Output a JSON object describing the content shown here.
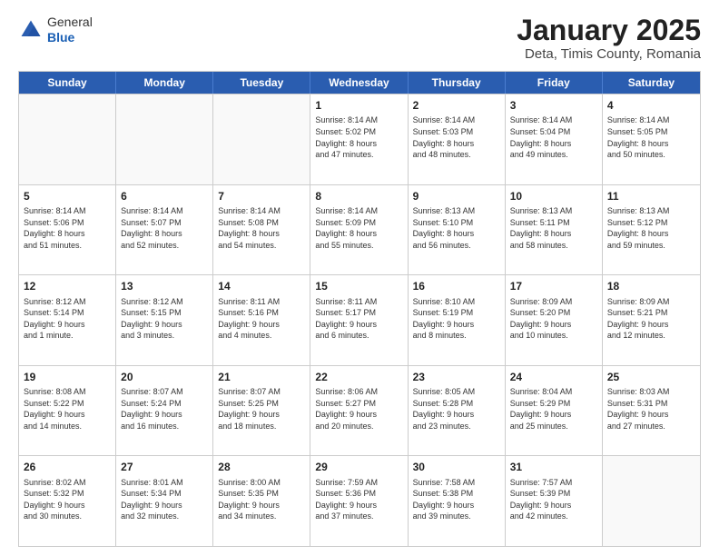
{
  "logo": {
    "general": "General",
    "blue": "Blue"
  },
  "title": "January 2025",
  "subtitle": "Deta, Timis County, Romania",
  "days_of_week": [
    "Sunday",
    "Monday",
    "Tuesday",
    "Wednesday",
    "Thursday",
    "Friday",
    "Saturday"
  ],
  "weeks": [
    [
      {
        "day": "",
        "text": "",
        "empty": true
      },
      {
        "day": "",
        "text": "",
        "empty": true
      },
      {
        "day": "",
        "text": "",
        "empty": true
      },
      {
        "day": "1",
        "text": "Sunrise: 8:14 AM\nSunset: 5:02 PM\nDaylight: 8 hours\nand 47 minutes."
      },
      {
        "day": "2",
        "text": "Sunrise: 8:14 AM\nSunset: 5:03 PM\nDaylight: 8 hours\nand 48 minutes."
      },
      {
        "day": "3",
        "text": "Sunrise: 8:14 AM\nSunset: 5:04 PM\nDaylight: 8 hours\nand 49 minutes."
      },
      {
        "day": "4",
        "text": "Sunrise: 8:14 AM\nSunset: 5:05 PM\nDaylight: 8 hours\nand 50 minutes."
      }
    ],
    [
      {
        "day": "5",
        "text": "Sunrise: 8:14 AM\nSunset: 5:06 PM\nDaylight: 8 hours\nand 51 minutes."
      },
      {
        "day": "6",
        "text": "Sunrise: 8:14 AM\nSunset: 5:07 PM\nDaylight: 8 hours\nand 52 minutes."
      },
      {
        "day": "7",
        "text": "Sunrise: 8:14 AM\nSunset: 5:08 PM\nDaylight: 8 hours\nand 54 minutes."
      },
      {
        "day": "8",
        "text": "Sunrise: 8:14 AM\nSunset: 5:09 PM\nDaylight: 8 hours\nand 55 minutes."
      },
      {
        "day": "9",
        "text": "Sunrise: 8:13 AM\nSunset: 5:10 PM\nDaylight: 8 hours\nand 56 minutes."
      },
      {
        "day": "10",
        "text": "Sunrise: 8:13 AM\nSunset: 5:11 PM\nDaylight: 8 hours\nand 58 minutes."
      },
      {
        "day": "11",
        "text": "Sunrise: 8:13 AM\nSunset: 5:12 PM\nDaylight: 8 hours\nand 59 minutes."
      }
    ],
    [
      {
        "day": "12",
        "text": "Sunrise: 8:12 AM\nSunset: 5:14 PM\nDaylight: 9 hours\nand 1 minute."
      },
      {
        "day": "13",
        "text": "Sunrise: 8:12 AM\nSunset: 5:15 PM\nDaylight: 9 hours\nand 3 minutes."
      },
      {
        "day": "14",
        "text": "Sunrise: 8:11 AM\nSunset: 5:16 PM\nDaylight: 9 hours\nand 4 minutes."
      },
      {
        "day": "15",
        "text": "Sunrise: 8:11 AM\nSunset: 5:17 PM\nDaylight: 9 hours\nand 6 minutes."
      },
      {
        "day": "16",
        "text": "Sunrise: 8:10 AM\nSunset: 5:19 PM\nDaylight: 9 hours\nand 8 minutes."
      },
      {
        "day": "17",
        "text": "Sunrise: 8:09 AM\nSunset: 5:20 PM\nDaylight: 9 hours\nand 10 minutes."
      },
      {
        "day": "18",
        "text": "Sunrise: 8:09 AM\nSunset: 5:21 PM\nDaylight: 9 hours\nand 12 minutes."
      }
    ],
    [
      {
        "day": "19",
        "text": "Sunrise: 8:08 AM\nSunset: 5:22 PM\nDaylight: 9 hours\nand 14 minutes."
      },
      {
        "day": "20",
        "text": "Sunrise: 8:07 AM\nSunset: 5:24 PM\nDaylight: 9 hours\nand 16 minutes."
      },
      {
        "day": "21",
        "text": "Sunrise: 8:07 AM\nSunset: 5:25 PM\nDaylight: 9 hours\nand 18 minutes."
      },
      {
        "day": "22",
        "text": "Sunrise: 8:06 AM\nSunset: 5:27 PM\nDaylight: 9 hours\nand 20 minutes."
      },
      {
        "day": "23",
        "text": "Sunrise: 8:05 AM\nSunset: 5:28 PM\nDaylight: 9 hours\nand 23 minutes."
      },
      {
        "day": "24",
        "text": "Sunrise: 8:04 AM\nSunset: 5:29 PM\nDaylight: 9 hours\nand 25 minutes."
      },
      {
        "day": "25",
        "text": "Sunrise: 8:03 AM\nSunset: 5:31 PM\nDaylight: 9 hours\nand 27 minutes."
      }
    ],
    [
      {
        "day": "26",
        "text": "Sunrise: 8:02 AM\nSunset: 5:32 PM\nDaylight: 9 hours\nand 30 minutes."
      },
      {
        "day": "27",
        "text": "Sunrise: 8:01 AM\nSunset: 5:34 PM\nDaylight: 9 hours\nand 32 minutes."
      },
      {
        "day": "28",
        "text": "Sunrise: 8:00 AM\nSunset: 5:35 PM\nDaylight: 9 hours\nand 34 minutes."
      },
      {
        "day": "29",
        "text": "Sunrise: 7:59 AM\nSunset: 5:36 PM\nDaylight: 9 hours\nand 37 minutes."
      },
      {
        "day": "30",
        "text": "Sunrise: 7:58 AM\nSunset: 5:38 PM\nDaylight: 9 hours\nand 39 minutes."
      },
      {
        "day": "31",
        "text": "Sunrise: 7:57 AM\nSunset: 5:39 PM\nDaylight: 9 hours\nand 42 minutes."
      },
      {
        "day": "",
        "text": "",
        "empty": true
      }
    ]
  ]
}
